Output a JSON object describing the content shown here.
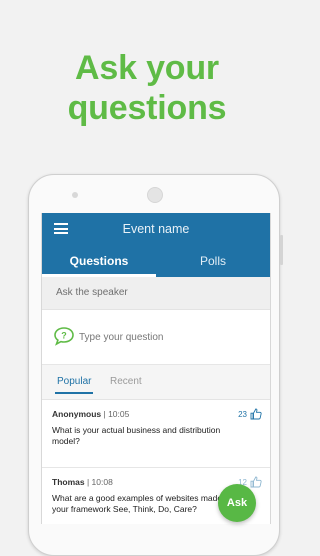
{
  "headline": {
    "line1": "Ask your",
    "line2": "questions"
  },
  "appbar": {
    "title": "Event name",
    "menu_icon": "hamburger-menu-icon"
  },
  "tabs": [
    {
      "label": "Questions",
      "active": true
    },
    {
      "label": "Polls",
      "active": false
    }
  ],
  "ask_section": {
    "label": "Ask the speaker",
    "placeholder": "Type your question",
    "icon": "question-bubble-icon"
  },
  "filters": [
    {
      "label": "Popular",
      "active": true
    },
    {
      "label": "Recent",
      "active": false
    }
  ],
  "questions": [
    {
      "author": "Anonymous",
      "time": "10:05",
      "likes": "23",
      "text": "What is your actual business and distribution model?"
    },
    {
      "author": "Thomas",
      "time": "10:08",
      "likes": "12",
      "text": "What are a good examples of websites made by your framework See, Think, Do, Care?"
    }
  ],
  "fab": {
    "label": "Ask"
  },
  "colors": {
    "brand_green": "#5fbb46",
    "appbar_blue": "#1f72a6"
  }
}
